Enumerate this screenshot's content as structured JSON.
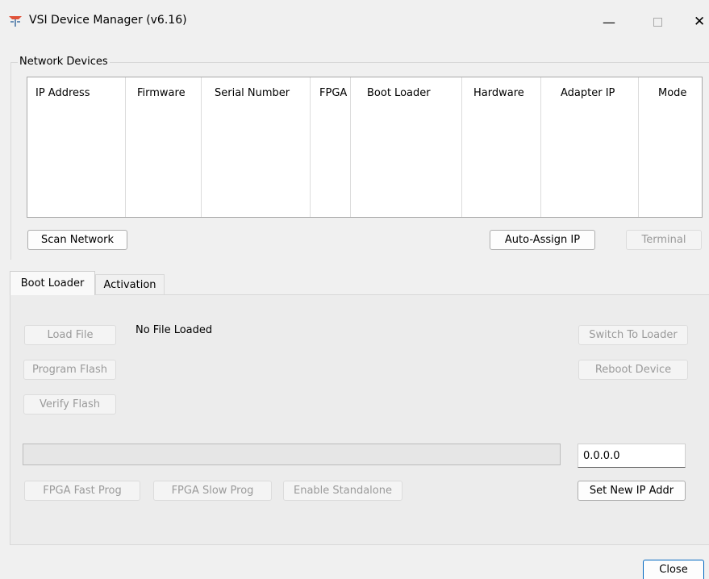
{
  "window": {
    "title": "VSI Device Manager (v6.16)",
    "minimize_glyph": "—",
    "close_glyph": "✕"
  },
  "network_devices": {
    "group_label": "Network Devices",
    "columns": [
      "IP Address",
      "Firmware",
      "Serial Number",
      "FPGA",
      "Boot Loader",
      "Hardware",
      "Adapter IP",
      "Mode"
    ],
    "rows": []
  },
  "buttons": {
    "scan_network": "Scan Network",
    "auto_assign_ip": "Auto-Assign IP",
    "terminal": "Terminal",
    "load_file": "Load File",
    "program_flash": "Program Flash",
    "verify_flash": "Verify Flash",
    "switch_to_loader": "Switch To Loader",
    "reboot_device": "Reboot Device",
    "fpga_fast_prog": "FPGA Fast Prog",
    "fpga_slow_prog": "FPGA Slow Prog",
    "enable_standalone": "Enable Standalone",
    "set_new_ip_addr": "Set New IP Addr",
    "close": "Close"
  },
  "tabs": [
    {
      "label": "Boot Loader",
      "active": true
    },
    {
      "label": "Activation",
      "active": false
    }
  ],
  "boot_loader": {
    "file_status": "No File Loaded",
    "progress": 0,
    "ip_value": "0.0.0.0"
  },
  "icons": {
    "app": "vsi-app-icon"
  }
}
